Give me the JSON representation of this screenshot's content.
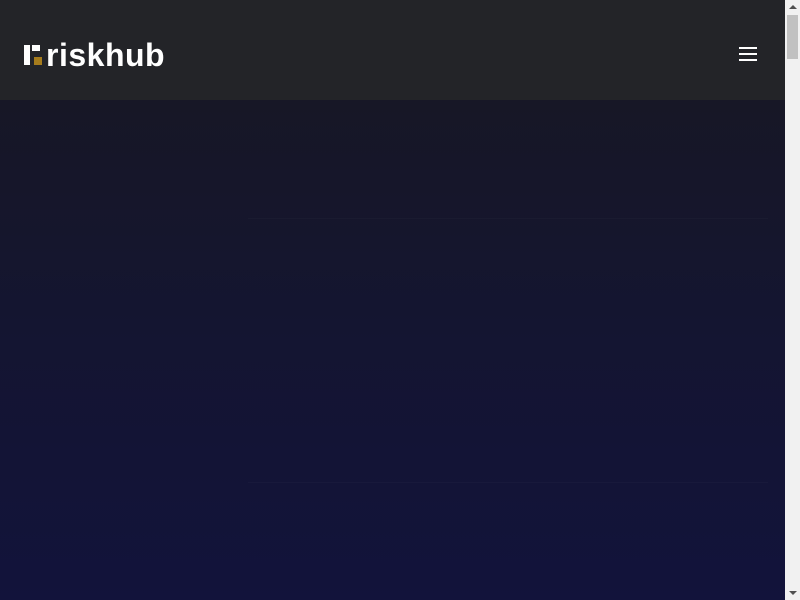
{
  "header": {
    "logo_text": "riskhub",
    "logo_icon": "riskhub-logo-mark",
    "menu_icon": "hamburger-menu-icon"
  },
  "colors": {
    "header_background": "#232428",
    "hero_top": "#171726",
    "hero_bottom": "#12133b",
    "logo_accent": "#a67c1d",
    "logo_text": "#ffffff"
  },
  "scrollbar": {
    "position_fraction": 0
  }
}
